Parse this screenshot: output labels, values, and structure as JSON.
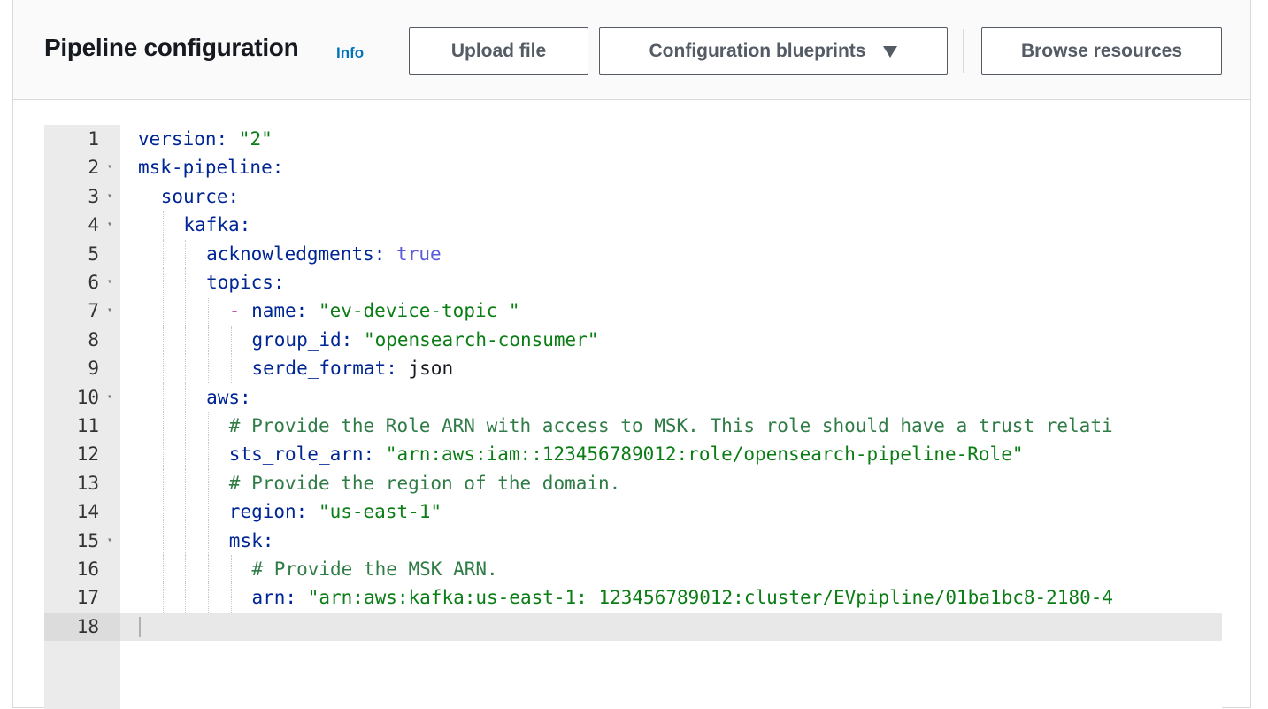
{
  "panel": {
    "title": "Pipeline configuration",
    "info_label": "Info"
  },
  "toolbar": {
    "upload_label": "Upload file",
    "blueprints_label": "Configuration blueprints",
    "browse_label": "Browse resources"
  },
  "editor": {
    "active_line": 18,
    "lines": [
      {
        "n": "1",
        "fold": false,
        "indent": 0,
        "tokens": [
          {
            "t": "key",
            "v": "version:"
          },
          {
            "t": "plain",
            "v": " "
          },
          {
            "t": "str",
            "v": "\"2\""
          }
        ]
      },
      {
        "n": "2",
        "fold": true,
        "indent": 0,
        "tokens": [
          {
            "t": "key",
            "v": "msk-pipeline:"
          }
        ]
      },
      {
        "n": "3",
        "fold": true,
        "indent": 1,
        "tokens": [
          {
            "t": "key",
            "v": "source:"
          }
        ]
      },
      {
        "n": "4",
        "fold": true,
        "indent": 2,
        "tokens": [
          {
            "t": "key",
            "v": "kafka:"
          }
        ]
      },
      {
        "n": "5",
        "fold": false,
        "indent": 3,
        "tokens": [
          {
            "t": "key",
            "v": "acknowledgments:"
          },
          {
            "t": "plain",
            "v": " "
          },
          {
            "t": "bool",
            "v": "true"
          }
        ]
      },
      {
        "n": "6",
        "fold": true,
        "indent": 3,
        "tokens": [
          {
            "t": "key",
            "v": "topics:"
          }
        ]
      },
      {
        "n": "7",
        "fold": true,
        "indent": 4,
        "tokens": [
          {
            "t": "dash",
            "v": "- "
          },
          {
            "t": "key",
            "v": "name:"
          },
          {
            "t": "plain",
            "v": " "
          },
          {
            "t": "str",
            "v": "\"ev-device-topic \""
          }
        ]
      },
      {
        "n": "8",
        "fold": false,
        "indent": 5,
        "tokens": [
          {
            "t": "key",
            "v": "group_id:"
          },
          {
            "t": "plain",
            "v": " "
          },
          {
            "t": "str",
            "v": "\"opensearch-consumer\""
          }
        ]
      },
      {
        "n": "9",
        "fold": false,
        "indent": 5,
        "tokens": [
          {
            "t": "key",
            "v": "serde_format:"
          },
          {
            "t": "plain",
            "v": " json"
          }
        ]
      },
      {
        "n": "10",
        "fold": true,
        "indent": 3,
        "tokens": [
          {
            "t": "key",
            "v": "aws:"
          }
        ]
      },
      {
        "n": "11",
        "fold": false,
        "indent": 4,
        "tokens": [
          {
            "t": "com",
            "v": "# Provide the Role ARN with access to MSK. This role should have a trust relati"
          }
        ]
      },
      {
        "n": "12",
        "fold": false,
        "indent": 4,
        "tokens": [
          {
            "t": "key",
            "v": "sts_role_arn:"
          },
          {
            "t": "plain",
            "v": " "
          },
          {
            "t": "str",
            "v": "\"arn:aws:iam::123456789012:role/opensearch-pipeline-Role\""
          }
        ]
      },
      {
        "n": "13",
        "fold": false,
        "indent": 4,
        "tokens": [
          {
            "t": "com",
            "v": "# Provide the region of the domain."
          }
        ]
      },
      {
        "n": "14",
        "fold": false,
        "indent": 4,
        "tokens": [
          {
            "t": "key",
            "v": "region:"
          },
          {
            "t": "plain",
            "v": " "
          },
          {
            "t": "str",
            "v": "\"us-east-1\""
          }
        ]
      },
      {
        "n": "15",
        "fold": true,
        "indent": 4,
        "tokens": [
          {
            "t": "key",
            "v": "msk:"
          }
        ]
      },
      {
        "n": "16",
        "fold": false,
        "indent": 5,
        "tokens": [
          {
            "t": "com",
            "v": "# Provide the MSK ARN."
          }
        ]
      },
      {
        "n": "17",
        "fold": false,
        "indent": 5,
        "tokens": [
          {
            "t": "key",
            "v": "arn:"
          },
          {
            "t": "plain",
            "v": " "
          },
          {
            "t": "str",
            "v": "\"arn:aws:kafka:us-east-1: 123456789012:cluster/EVpipline/01ba1bc8-2180-4"
          }
        ]
      },
      {
        "n": "18",
        "fold": false,
        "indent": 0,
        "tokens": []
      }
    ]
  }
}
